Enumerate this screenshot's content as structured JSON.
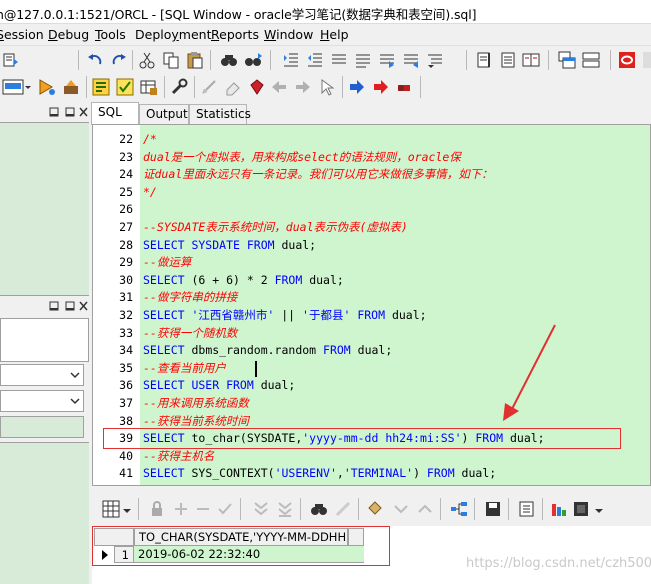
{
  "window": {
    "title": "n@127.0.0.1:1521/ORCL - [SQL Window - oracle学习笔记(数据字典和表空间).sql]"
  },
  "menu": [
    {
      "pre": "",
      "key": "S",
      "post": "ession"
    },
    {
      "pre": "",
      "key": "D",
      "post": "ebug"
    },
    {
      "pre": "",
      "key": "T",
      "post": "ools"
    },
    {
      "pre": "Deplo",
      "key": "y",
      "post": "ment"
    },
    {
      "pre": "",
      "key": "R",
      "post": "eports"
    },
    {
      "pre": "",
      "key": "W",
      "post": "indow"
    },
    {
      "pre": "",
      "key": "H",
      "post": "elp"
    }
  ],
  "tabs": [
    "SQL",
    "Output",
    "Statistics"
  ],
  "editor": {
    "lines": [
      {
        "n": "22",
        "parts": [
          {
            "c": "cm",
            "t": "/*"
          }
        ]
      },
      {
        "n": "23",
        "parts": [
          {
            "c": "cm",
            "t": "dual是一个虚拟表，用来构成select的语法规则，oracle保"
          }
        ]
      },
      {
        "n": "24",
        "parts": [
          {
            "c": "cm",
            "t": "证dual里面永远只有一条记录。我们可以用它来做很多事情，如下："
          }
        ]
      },
      {
        "n": "25",
        "parts": [
          {
            "c": "cm",
            "t": "*/"
          }
        ]
      },
      {
        "n": "26",
        "parts": []
      },
      {
        "n": "27",
        "parts": [
          {
            "c": "cm",
            "t": "--SYSDATE表示系统时间，dual表示伪表(虚拟表)"
          }
        ]
      },
      {
        "n": "28",
        "parts": [
          {
            "c": "kw",
            "t": "SELECT SYSDATE FROM "
          },
          {
            "c": "tx",
            "t": "dual;"
          }
        ]
      },
      {
        "n": "29",
        "parts": [
          {
            "c": "cm",
            "t": "--做运算"
          }
        ]
      },
      {
        "n": "30",
        "parts": [
          {
            "c": "kw",
            "t": "SELECT "
          },
          {
            "c": "tx",
            "t": "(6 + 6) * 2 "
          },
          {
            "c": "kw",
            "t": "FROM "
          },
          {
            "c": "tx",
            "t": "dual;"
          }
        ]
      },
      {
        "n": "31",
        "parts": [
          {
            "c": "cm",
            "t": "--做字符串的拼接"
          }
        ]
      },
      {
        "n": "32",
        "parts": [
          {
            "c": "kw",
            "t": "SELECT "
          },
          {
            "c": "st",
            "t": "'江西省赣州市'"
          },
          {
            "c": "tx",
            "t": " || "
          },
          {
            "c": "st",
            "t": "'于都县'"
          },
          {
            "c": "kw",
            "t": " FROM "
          },
          {
            "c": "tx",
            "t": "dual;"
          }
        ]
      },
      {
        "n": "33",
        "parts": [
          {
            "c": "cm",
            "t": "--获得一个随机数"
          }
        ]
      },
      {
        "n": "34",
        "parts": [
          {
            "c": "kw",
            "t": "SELECT "
          },
          {
            "c": "tx",
            "t": "dbms_random.random "
          },
          {
            "c": "kw",
            "t": "FROM "
          },
          {
            "c": "tx",
            "t": "dual;"
          }
        ]
      },
      {
        "n": "35",
        "parts": [
          {
            "c": "cm",
            "t": "--查看当前用户"
          }
        ]
      },
      {
        "n": "36",
        "parts": [
          {
            "c": "kw",
            "t": "SELECT USER FROM "
          },
          {
            "c": "tx",
            "t": "dual;"
          }
        ]
      },
      {
        "n": "37",
        "parts": [
          {
            "c": "cm",
            "t": "--用来调用系统函数"
          }
        ]
      },
      {
        "n": "38",
        "parts": [
          {
            "c": "cm",
            "t": "--获得当前系统时间"
          }
        ]
      },
      {
        "n": "39",
        "parts": [
          {
            "c": "kw",
            "t": "SELECT "
          },
          {
            "c": "tx",
            "t": "to_char(SYSDATE,"
          },
          {
            "c": "st",
            "t": "'yyyy-mm-dd hh24:mi:SS'"
          },
          {
            "c": "tx",
            "t": ") "
          },
          {
            "c": "kw",
            "t": "FROM "
          },
          {
            "c": "tx",
            "t": "dual;"
          }
        ]
      },
      {
        "n": "40",
        "parts": [
          {
            "c": "cm",
            "t": "--获得主机名"
          }
        ]
      },
      {
        "n": "41",
        "parts": [
          {
            "c": "kw",
            "t": "SELECT "
          },
          {
            "c": "tx",
            "t": "SYS_CONTEXT("
          },
          {
            "c": "st",
            "t": "'USERENV'"
          },
          {
            "c": "tx",
            "t": ","
          },
          {
            "c": "st",
            "t": "'TERMINAL'"
          },
          {
            "c": "tx",
            "t": ") "
          },
          {
            "c": "kw",
            "t": "FROM "
          },
          {
            "c": "tx",
            "t": "dual;"
          }
        ]
      }
    ]
  },
  "result": {
    "column": "TO_CHAR(SYSDATE,'YYYY-MM-DDHH2",
    "row_number": "1",
    "value": "2019-06-02 22:32:40"
  },
  "watermark": "https://blog.csdn.net/czh500",
  "colors": {
    "editor_bg": "#cff5cf",
    "keyword": "#0000ff",
    "comment": "#ff0000",
    "annotation": "#e03030"
  }
}
